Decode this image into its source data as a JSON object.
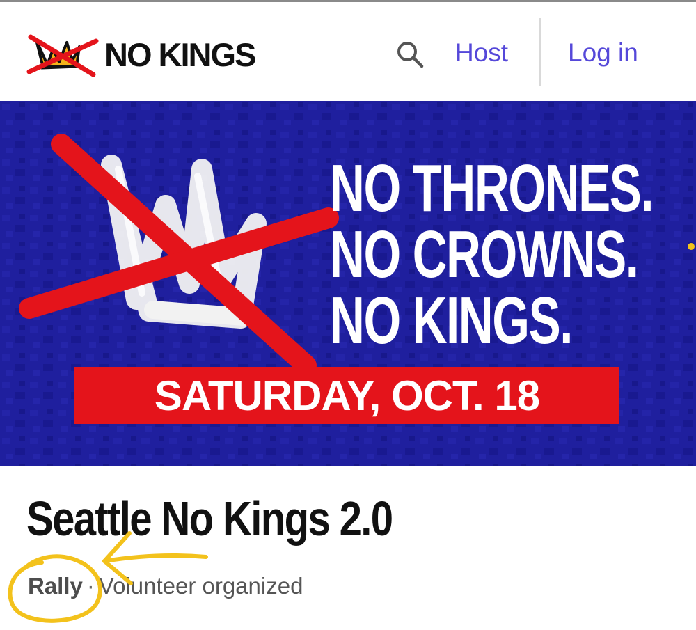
{
  "header": {
    "logo_text": "NO KINGS",
    "search_icon": "search-icon",
    "host_label": "Host",
    "login_label": "Log in",
    "link_color": "#5548d9"
  },
  "hero": {
    "headline_lines": [
      "NO THRONES.",
      "NO CROWNS.",
      "NO KINGS."
    ],
    "date_text": "SATURDAY, OCT. 18",
    "colors": {
      "background": "#1f1f9e",
      "banner_red": "#e4141b",
      "text": "#ffffff"
    },
    "image": "crossed-out-crown-graphic"
  },
  "event": {
    "title": "Seattle No Kings 2.0",
    "type": "Rally",
    "separator": "·",
    "organizer": "Volunteer organized"
  },
  "annotation": {
    "color": "#f3c21c",
    "shapes": [
      "circle-around-rally",
      "arrow-pointing-left"
    ]
  }
}
